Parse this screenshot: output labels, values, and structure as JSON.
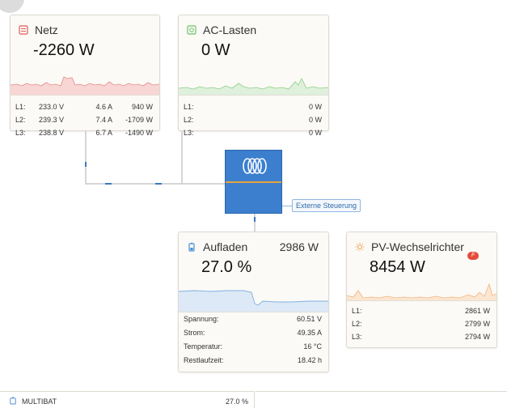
{
  "grid": {
    "title": "Netz",
    "value": "-2260 W",
    "icon": "grid-icon",
    "phases": [
      {
        "label": "L1:",
        "voltage": "233.0 V",
        "current": "4.6 A",
        "power": "940 W"
      },
      {
        "label": "L2:",
        "voltage": "239.3 V",
        "current": "7.4 A",
        "power": "-1709 W"
      },
      {
        "label": "L3:",
        "voltage": "238.8 V",
        "current": "6.7 A",
        "power": "-1490 W"
      }
    ],
    "color": "#e05a55"
  },
  "ac_loads": {
    "title": "AC-Lasten",
    "value": "0 W",
    "icon": "ac-loads-icon",
    "phases": [
      {
        "label": "L1:",
        "power": "0 W"
      },
      {
        "label": "L2:",
        "power": "0 W"
      },
      {
        "label": "L3:",
        "power": "0 W"
      }
    ],
    "color": "#6cc06a"
  },
  "inverter": {
    "logo": "victron-logo-icon",
    "external_control_label": "Externe Steuerung",
    "color": "#3c7fcf"
  },
  "battery": {
    "title": "Aufladen",
    "power": "2986 W",
    "soc": "27.0 %",
    "icon": "battery-icon",
    "rows": [
      {
        "label": "Spannung:",
        "value": "60.51 V"
      },
      {
        "label": "Strom:",
        "value": "49.35 A"
      },
      {
        "label": "Temperatur:",
        "value": "16 °C"
      },
      {
        "label": "Restlaufzeit:",
        "value": "18.42 h"
      }
    ],
    "color": "#4a8fd6"
  },
  "pv_inverter": {
    "title": "PV-Wechselrichter",
    "value": "8454 W",
    "icon": "sun-icon",
    "badge_icon": "fronius-badge-icon",
    "phases": [
      {
        "label": "L1:",
        "power": "2861 W"
      },
      {
        "label": "L2:",
        "power": "2799 W"
      },
      {
        "label": "L3:",
        "power": "2794 W"
      }
    ],
    "color": "#f0a860"
  },
  "bottom_bar": {
    "label": "MULTIBAT",
    "value": "27.0 %",
    "icon": "battery-small-icon"
  }
}
